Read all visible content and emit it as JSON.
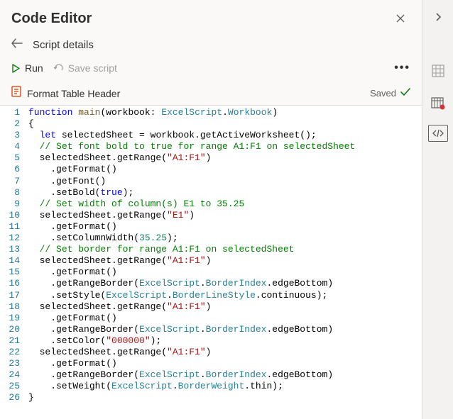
{
  "header": {
    "title": "Code Editor"
  },
  "breadcrumb": {
    "label": "Script details"
  },
  "toolbar": {
    "run": "Run",
    "save": "Save script"
  },
  "file": {
    "name": "Format Table Header",
    "status": "Saved"
  },
  "code": {
    "lines": [
      [
        [
          "k-blue",
          "function"
        ],
        [
          "",
          " "
        ],
        [
          "k-fn",
          "main"
        ],
        [
          "",
          "(workbook: "
        ],
        [
          "k-teal",
          "ExcelScript"
        ],
        [
          "",
          "."
        ],
        [
          "k-teal",
          "Workbook"
        ],
        [
          "",
          ")"
        ]
      ],
      [
        [
          "",
          "{"
        ]
      ],
      [
        [
          "",
          "  "
        ],
        [
          "k-blue",
          "let"
        ],
        [
          "",
          " selectedSheet = workbook.getActiveWorksheet();"
        ]
      ],
      [
        [
          "",
          "  "
        ],
        [
          "k-green",
          "// Set font bold to true for range A1:F1 on selectedSheet"
        ]
      ],
      [
        [
          "",
          "  selectedSheet.getRange("
        ],
        [
          "k-red",
          "\"A1:F1\""
        ],
        [
          "",
          ")"
        ]
      ],
      [
        [
          "",
          "    .getFormat()"
        ]
      ],
      [
        [
          "",
          "    .getFont()"
        ]
      ],
      [
        [
          "",
          "    .setBold("
        ],
        [
          "k-blue",
          "true"
        ],
        [
          "",
          ");"
        ]
      ],
      [
        [
          "",
          "  "
        ],
        [
          "k-green",
          "// Set width of column(s) E1 to 35.25"
        ]
      ],
      [
        [
          "",
          "  selectedSheet.getRange("
        ],
        [
          "k-red",
          "\"E1\""
        ],
        [
          "",
          ")"
        ]
      ],
      [
        [
          "",
          "    .getFormat()"
        ]
      ],
      [
        [
          "",
          "    .setColumnWidth("
        ],
        [
          "k-num",
          "35.25"
        ],
        [
          "",
          ");"
        ]
      ],
      [
        [
          "",
          "  "
        ],
        [
          "k-green",
          "// Set border for range A1:F1 on selectedSheet"
        ]
      ],
      [
        [
          "",
          "  selectedSheet.getRange("
        ],
        [
          "k-red",
          "\"A1:F1\""
        ],
        [
          "",
          ")"
        ]
      ],
      [
        [
          "",
          "    .getFormat()"
        ]
      ],
      [
        [
          "",
          "    .getRangeBorder("
        ],
        [
          "k-teal",
          "ExcelScript"
        ],
        [
          "",
          "."
        ],
        [
          "k-teal",
          "BorderIndex"
        ],
        [
          "",
          ".edgeBottom)"
        ]
      ],
      [
        [
          "",
          "    .setStyle("
        ],
        [
          "k-teal",
          "ExcelScript"
        ],
        [
          "",
          "."
        ],
        [
          "k-teal",
          "BorderLineStyle"
        ],
        [
          "",
          ".continuous);"
        ]
      ],
      [
        [
          "",
          "  selectedSheet.getRange("
        ],
        [
          "k-red",
          "\"A1:F1\""
        ],
        [
          "",
          ")"
        ]
      ],
      [
        [
          "",
          "    .getFormat()"
        ]
      ],
      [
        [
          "",
          "    .getRangeBorder("
        ],
        [
          "k-teal",
          "ExcelScript"
        ],
        [
          "",
          "."
        ],
        [
          "k-teal",
          "BorderIndex"
        ],
        [
          "",
          ".edgeBottom)"
        ]
      ],
      [
        [
          "",
          "    .setColor("
        ],
        [
          "k-red",
          "\"000000\""
        ],
        [
          "",
          ");"
        ]
      ],
      [
        [
          "",
          "  selectedSheet.getRange("
        ],
        [
          "k-red",
          "\"A1:F1\""
        ],
        [
          "",
          ")"
        ]
      ],
      [
        [
          "",
          "    .getFormat()"
        ]
      ],
      [
        [
          "",
          "    .getRangeBorder("
        ],
        [
          "k-teal",
          "ExcelScript"
        ],
        [
          "",
          "."
        ],
        [
          "k-teal",
          "BorderIndex"
        ],
        [
          "",
          ".edgeBottom)"
        ]
      ],
      [
        [
          "",
          "    .setWeight("
        ],
        [
          "k-teal",
          "ExcelScript"
        ],
        [
          "",
          "."
        ],
        [
          "k-teal",
          "BorderWeight"
        ],
        [
          "",
          ".thin);"
        ]
      ],
      [
        [
          "",
          "}"
        ]
      ]
    ]
  }
}
